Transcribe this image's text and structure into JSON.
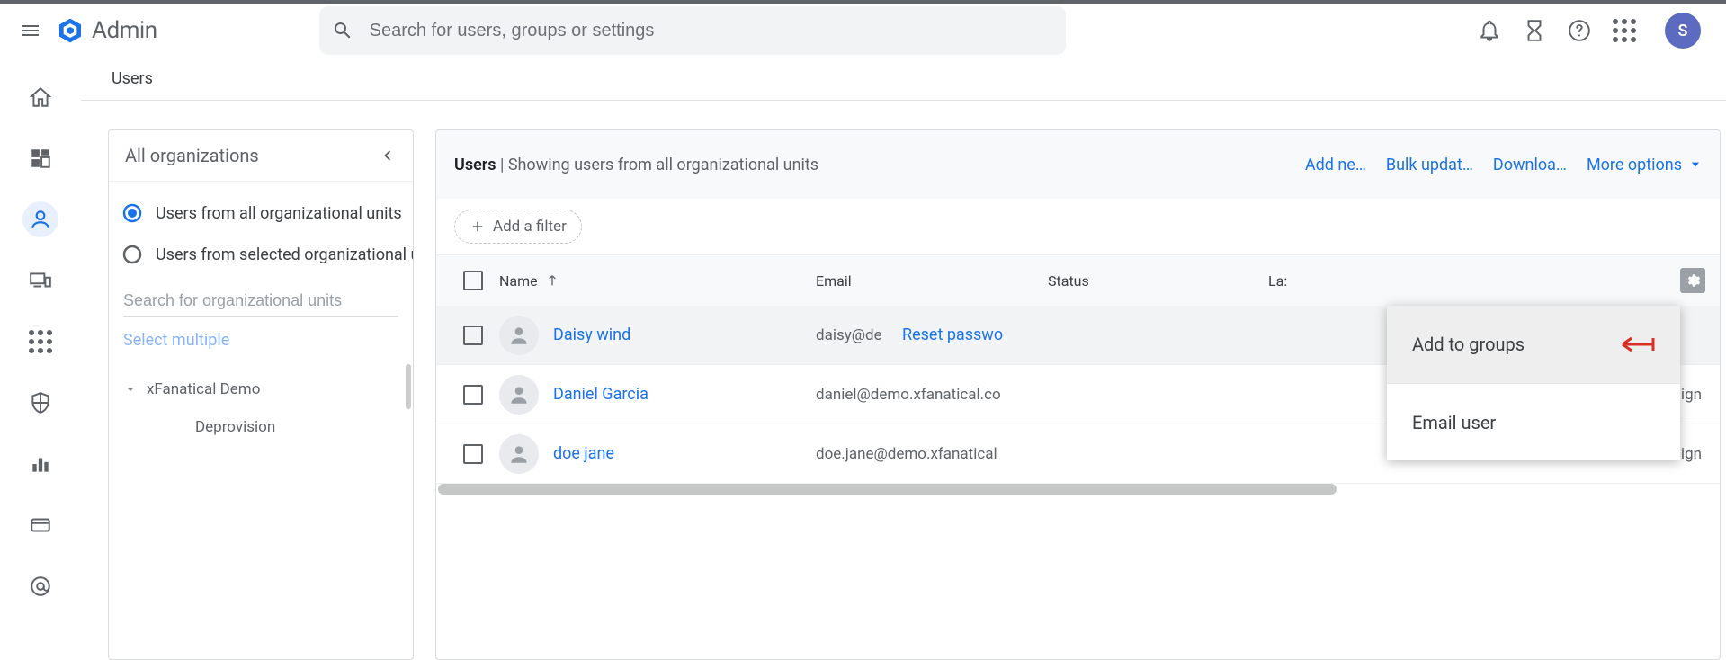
{
  "header": {
    "product": "Admin",
    "search_placeholder": "Search for users, groups or settings",
    "avatar_initial": "S"
  },
  "breadcrumb": "Users",
  "ou_panel": {
    "title": "All organizations",
    "radio_all": "Users from all organizational units",
    "radio_selected": "Users from selected organizational units",
    "search_placeholder": "Search for organizational units",
    "select_multiple": "Select multiple",
    "tree_root": "xFanatical Demo",
    "tree_child1": "Deprovision"
  },
  "users_panel": {
    "heading_prefix": "Users",
    "heading_rest": " | Showing users from all organizational units",
    "actions": {
      "add": "Add ne…",
      "bulk": "Bulk updat…",
      "download": "Downloa…",
      "more": "More options"
    },
    "add_filter": "Add a filter",
    "columns": {
      "name": "Name",
      "email": "Email",
      "status": "Status",
      "last": "Last sign in"
    },
    "rows": [
      {
        "name": "Daisy wind",
        "email": "daisy@demo.xfanatical.com",
        "action": "Reset password",
        "last": ""
      },
      {
        "name": "Daniel Garcia",
        "email": "daniel@demo.xfanatical.com",
        "action": "",
        "last": "sign"
      },
      {
        "name": "doe jane",
        "email": "doe.jane@demo.xfanatical.com",
        "action": "",
        "last": "sign"
      }
    ]
  },
  "context_menu": {
    "item1": "Add to groups",
    "item2": "Email user"
  }
}
